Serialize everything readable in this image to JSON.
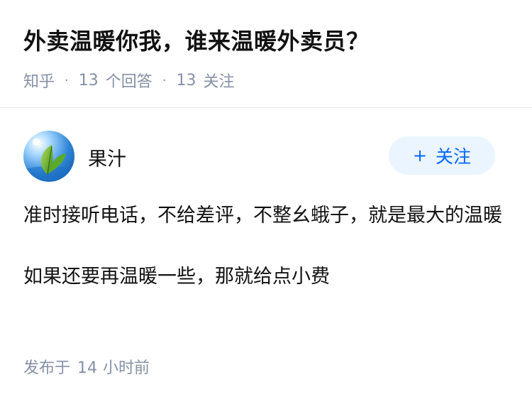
{
  "question": {
    "title": "外卖温暖你我，谁来温暖外卖员？",
    "source": "知乎",
    "answer_count": "13",
    "answer_label": "个回答",
    "follower_count": "13",
    "follower_label": "关注"
  },
  "author": {
    "name": "果汁",
    "avatar_icon": "leaf-avatar-icon"
  },
  "follow_button": {
    "icon": "plus-icon",
    "label": "关注",
    "bg_color": "#ebf5ff",
    "text_color": "#0066ff"
  },
  "answer": {
    "paragraphs": [
      "准时接听电话，不给差评，不整幺蛾子，就是最大的温暖",
      "如果还要再温暖一些，那就给点小费"
    ]
  },
  "meta": {
    "published_prefix": "发布于",
    "published_value": "14",
    "published_suffix": "小时前"
  }
}
